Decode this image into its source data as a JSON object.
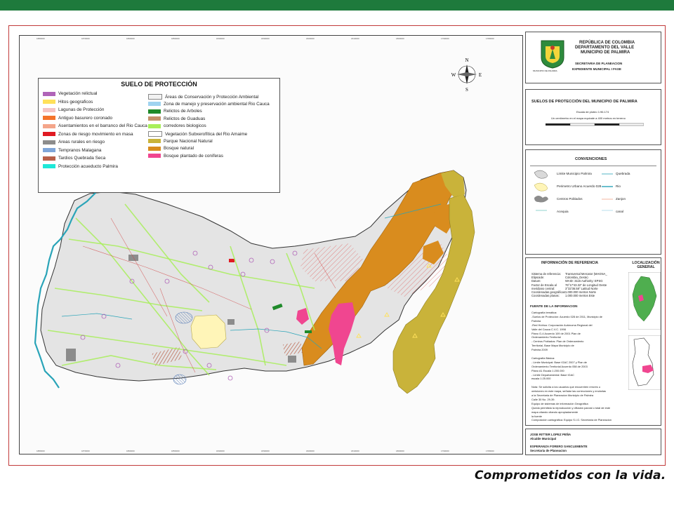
{
  "slogan": "Comprometidos con la vida.",
  "map": {
    "north_label": "N",
    "south_label": "S",
    "east_label": "E",
    "west_label": "W",
    "top_coords": [
      "1880000",
      "1870000",
      "1860000",
      "1850000",
      "1840000",
      "1830000",
      "1820000",
      "1810000",
      "1800000",
      "1790000",
      "1780000"
    ],
    "legend": {
      "title": "SUELO DE PROTECCIÓN",
      "items": [
        {
          "label": "Vegetación relictual",
          "color": "#b064b8"
        },
        {
          "label": "Hitos geograficos",
          "color": "#ffe15a"
        },
        {
          "label": "Lagunas de Protección",
          "color": "#f5c4c4"
        },
        {
          "label": "Antiguo basurero coronado",
          "color": "#f4742a"
        },
        {
          "label": "Asentamientos en el barranco del Rio Cauca",
          "color": "#f4a58a"
        },
        {
          "label": "Zonas de riesgo movimiento en masa",
          "color": "#e01a22"
        },
        {
          "label": "Areas rurales en riesgo",
          "color": "#8c8c8c"
        },
        {
          "label": "Tempranos Malagana",
          "color": "#7fa6d9"
        },
        {
          "label": "Tardios Quebrada Seca",
          "color": "#b8614a"
        },
        {
          "label": "Protección acueducto Palmira",
          "color": "#1ee8d8"
        },
        {
          "label": "Áreas de Conservación y Protección Ambiental",
          "color": "#f2f2f2"
        },
        {
          "label": "Zona de manejo y preservación ambiental Rio Cauca",
          "color": "#9fd3f0"
        },
        {
          "label": "Relictos de Arboles",
          "color": "#1f8a2a"
        },
        {
          "label": "Relictos de Guaduas",
          "color": "#c4906a"
        },
        {
          "label": "corredores biologicos",
          "color": "#a8ef5a"
        },
        {
          "label": "Vegetación Subxerofítica del Rio Amaime",
          "color": "#ffffff"
        },
        {
          "label": "Parque Nacional Natural",
          "color": "#c9b33a"
        },
        {
          "label": "Bosque natural",
          "color": "#d98c1e"
        },
        {
          "label": "Bosque plantado de coníferas",
          "color": "#f04690"
        }
      ]
    }
  },
  "header_panel": {
    "line1": "REPÚBLICA DE COLOMBIA",
    "line2": "DEPARTAMENTO DEL VALLE",
    "line3": "MUNICIPIO DE PALMIRA",
    "sub1": "SECRETARIA DE PLANEACION",
    "sub2": "EXPEDIENTE MUNICIPAL I FASE",
    "logo_caption": "MUNICIPIO DE PALMIRA"
  },
  "title_panel": {
    "title": "SUELOS DE PROTECCIÓN DEL MUNICIPIO DE PALMIRA",
    "scale": "Escala de ploteo 1:96.174",
    "note": "Un centímetro en el mapa equivale a 400 metros en terreno"
  },
  "conventions": {
    "title": "CONVENCIONES",
    "items": [
      {
        "label": "Limite Municipio Palmira"
      },
      {
        "label": "Quebrada"
      },
      {
        "label": "Perimetro Urbano Acuerdo 028"
      },
      {
        "label": "Rio"
      },
      {
        "label": "Centros Poblados"
      },
      {
        "label": "Zanjon"
      },
      {
        "label": "Acequia"
      },
      {
        "label": "canal"
      }
    ]
  },
  "info_panel": {
    "title": "INFORMACIÓN DE REFERENCIA",
    "ref_lines": [
      "Sistema de referencia:",
      "Elipsoide:",
      "Datum:",
      "Factor de Escala al",
      "meridiano central:",
      "Coordenadas geográficas:",
      "Coordenadas planas:"
    ],
    "ref_values": [
      "Transversal Mercator (MAGNA_",
      "Colombia_Oeste)",
      "WAID: 3115 Authority: EPSG",
      "76°17'43.32\" de Longitud Oeste",
      "3°32'36.58\" Latitud Norte",
      "1.000.000 metros Norte",
      "1.000.000 metros Este"
    ],
    "source_title": "FUENTE DE LA INFORMACION",
    "source_lines": [
      "Cartografía temática:",
      "-Suelos de Protección: Acuerdo 028 de 2011, Municipio de",
      "Palmira",
      "-Red Hídrica: Corporación Autónoma Regional del",
      "Valle del Cauca C.V.C. 1998",
      "Plano G-4 Acuerdo 109 de 2001 Plan de",
      "Ordenamiento Territorial",
      "- Centros Poblados: Plan de Ordenamiento",
      "Territorial, Base Mapa Municipio de",
      "Palmira 2009",
      "",
      "Cartografía Básica:",
      "- Limite Municipal: Base IGAC 2007 y Plan de",
      "Ordenamiento Territorial Acuerdo 058 de 2003",
      "Plano A1 Escala 1:200.000",
      "- Limite Departamental: Base IGAC",
      "escala 1:25.000",
      "",
      "Nota: Se solicita a los usuarios que encuentren errores u",
      "omisiones en este mapa, señalar las correcciones y enviarlas",
      "a la Secretaria de Planeacion Municipio de Palmira",
      "Calle 30 No. 29-39.",
      "Equipo de sistemas de información Geográfica",
      "Queda permitida la reproducción y difusión parcial o total de este",
      "mapa citando citando apropiadamente",
      "la fuente",
      "Composición cartográfica: Equipo S.I.G. Secretaría de Planeacion"
    ],
    "loc_title": "LOCALIZACIÓN GENERAL"
  },
  "signatures": {
    "name1": "JOSE RITTER LOPEZ PEÑA",
    "role1": "Alcalde Municipal",
    "name2": "ESPERANZA FORERO SANCLEMENTE",
    "role2": "Secretaria de Planeacion"
  }
}
